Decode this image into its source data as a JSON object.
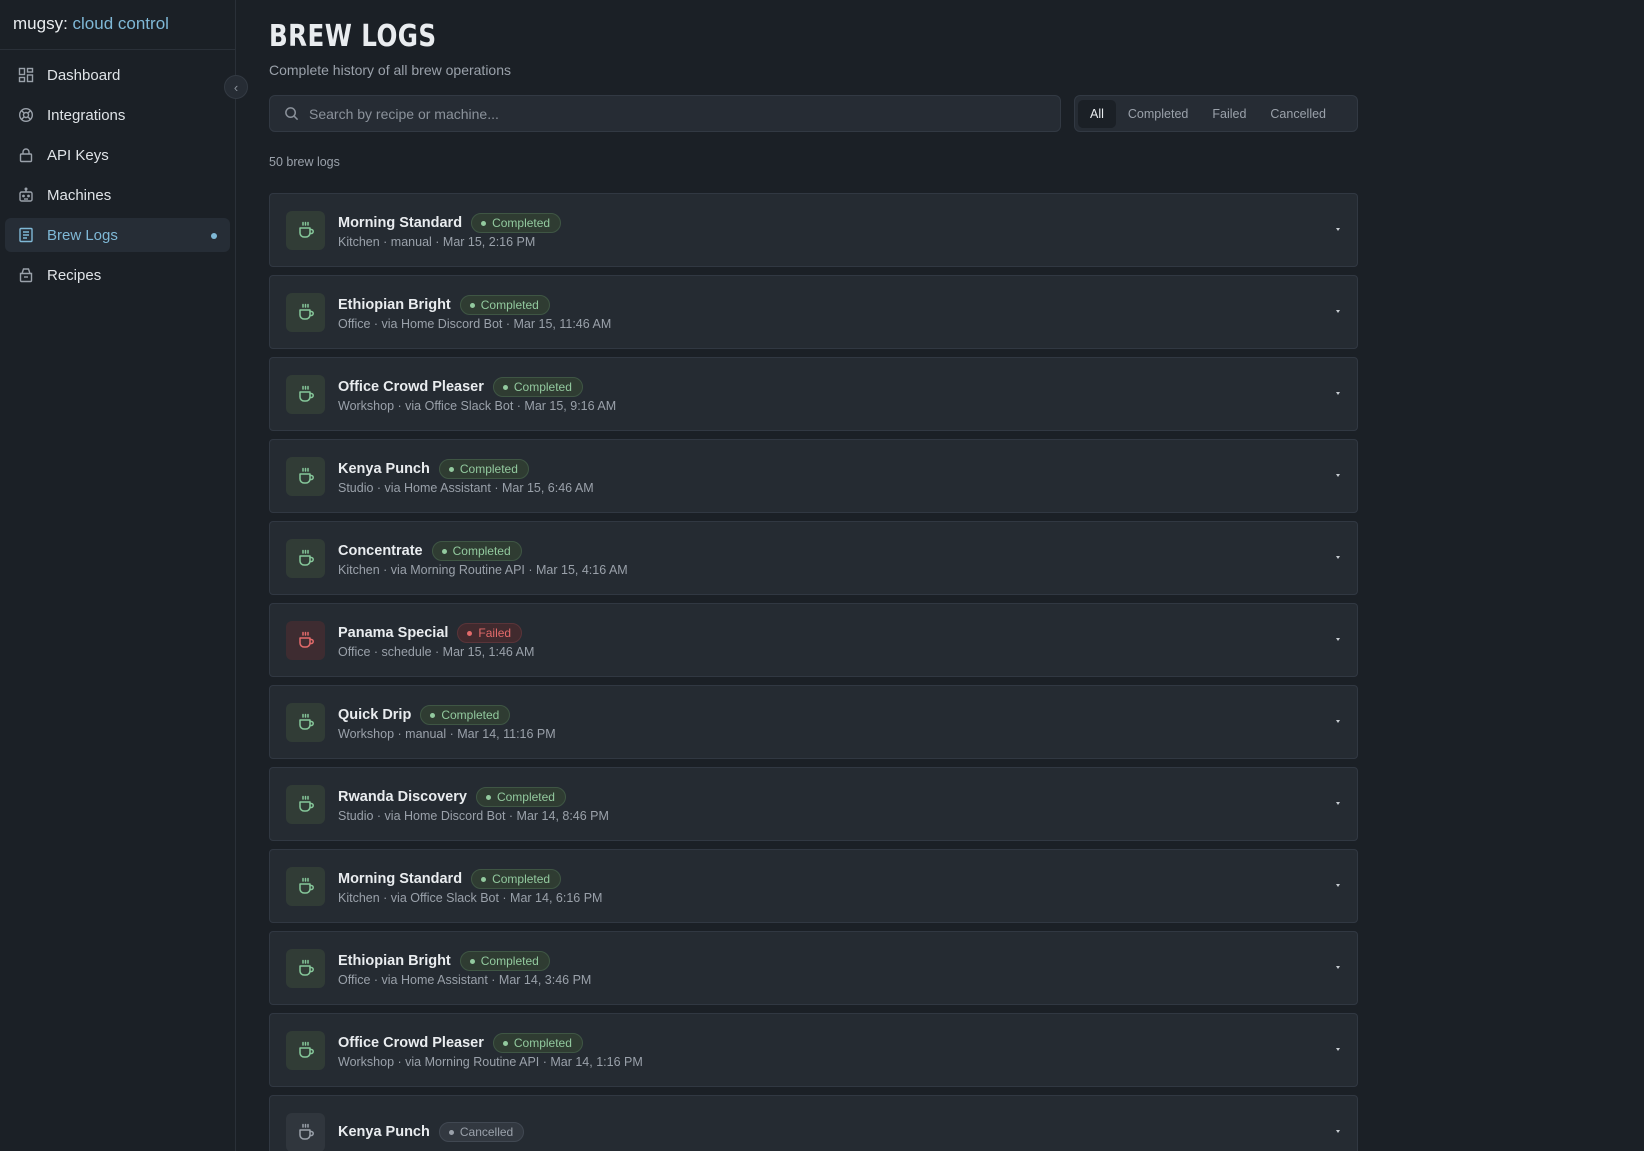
{
  "brand": {
    "prefix": "mugsy:",
    "accent": "cloud control"
  },
  "sidebar": {
    "items": [
      {
        "label": "Dashboard",
        "icon": "dashboard-icon",
        "active": false
      },
      {
        "label": "Integrations",
        "icon": "integrations-icon",
        "active": false
      },
      {
        "label": "API Keys",
        "icon": "lock-icon",
        "active": false
      },
      {
        "label": "Machines",
        "icon": "machine-icon",
        "active": false
      },
      {
        "label": "Brew Logs",
        "icon": "log-icon",
        "active": true
      },
      {
        "label": "Recipes",
        "icon": "recipe-icon",
        "active": false
      }
    ]
  },
  "header": {
    "title": "BREW LOGS",
    "subtitle": "Complete history of all brew operations"
  },
  "search": {
    "placeholder": "Search by recipe or machine...",
    "value": ""
  },
  "filters": {
    "options": [
      "All",
      "Completed",
      "Failed",
      "Cancelled"
    ],
    "selected": "All"
  },
  "count_label": "50 brew logs",
  "logs": [
    {
      "name": "Morning Standard",
      "status": "Completed",
      "meta": "Kitchen · manual · Mar 15, 2:16 PM"
    },
    {
      "name": "Ethiopian Bright",
      "status": "Completed",
      "meta": "Office · via Home Discord Bot · Mar 15, 11:46 AM"
    },
    {
      "name": "Office Crowd Pleaser",
      "status": "Completed",
      "meta": "Workshop · via Office Slack Bot · Mar 15, 9:16 AM"
    },
    {
      "name": "Kenya Punch",
      "status": "Completed",
      "meta": "Studio · via Home Assistant · Mar 15, 6:46 AM"
    },
    {
      "name": "Concentrate",
      "status": "Completed",
      "meta": "Kitchen · via Morning Routine API · Mar 15, 4:16 AM"
    },
    {
      "name": "Panama Special",
      "status": "Failed",
      "meta": "Office · schedule · Mar 15, 1:46 AM"
    },
    {
      "name": "Quick Drip",
      "status": "Completed",
      "meta": "Workshop · manual · Mar 14, 11:16 PM"
    },
    {
      "name": "Rwanda Discovery",
      "status": "Completed",
      "meta": "Studio · via Home Discord Bot · Mar 14, 8:46 PM"
    },
    {
      "name": "Morning Standard",
      "status": "Completed",
      "meta": "Kitchen · via Office Slack Bot · Mar 14, 6:16 PM"
    },
    {
      "name": "Ethiopian Bright",
      "status": "Completed",
      "meta": "Office · via Home Assistant · Mar 14, 3:46 PM"
    },
    {
      "name": "Office Crowd Pleaser",
      "status": "Completed",
      "meta": "Workshop · via Morning Routine API · Mar 14, 1:16 PM"
    },
    {
      "name": "Kenya Punch",
      "status": "Cancelled",
      "meta": ""
    }
  ],
  "colors": {
    "accent": "#7fb8d6",
    "completed": "#92c99e",
    "failed": "#e26a6a",
    "cancelled": "#9aa1aa",
    "background": "#1b2026"
  }
}
